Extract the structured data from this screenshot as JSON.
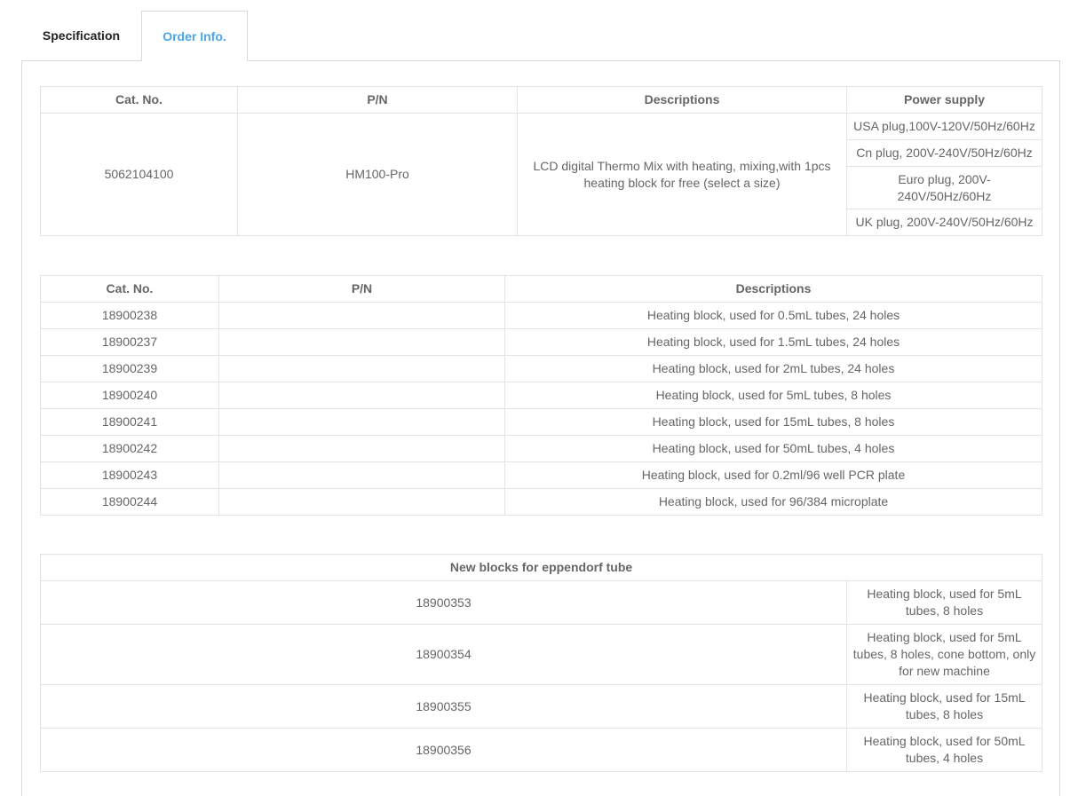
{
  "tabs": [
    {
      "label": "Specification",
      "active": false
    },
    {
      "label": "Order Info.",
      "active": true
    }
  ],
  "colors": {
    "active_tab": "#4aa6e8",
    "border": "#e3e3e3",
    "text": "#666666"
  },
  "table1": {
    "headers": [
      "Cat. No.",
      "P/N",
      "Descriptions",
      "Power supply"
    ],
    "cat_no": "5062104100",
    "pn": "HM100-Pro",
    "description": "LCD digital Thermo Mix with heating, mixing,with 1pcs heating block for free (select a size)",
    "power_supply": [
      "USA plug,100V-120V/50Hz/60Hz",
      "Cn plug, 200V-240V/50Hz/60Hz",
      "Euro plug, 200V-240V/50Hz/60Hz",
      "UK plug, 200V-240V/50Hz/60Hz"
    ]
  },
  "table2": {
    "headers": [
      "Cat. No.",
      "P/N",
      "Descriptions"
    ],
    "rows": [
      {
        "cat": "18900238",
        "pn": "",
        "desc": "Heating block, used for 0.5mL tubes, 24 holes"
      },
      {
        "cat": "18900237",
        "pn": "",
        "desc": "Heating block, used for 1.5mL tubes, 24 holes"
      },
      {
        "cat": "18900239",
        "pn": "",
        "desc": "Heating block, used for 2mL tubes, 24 holes"
      },
      {
        "cat": "18900240",
        "pn": "",
        "desc": "Heating block, used for 5mL tubes, 8 holes"
      },
      {
        "cat": "18900241",
        "pn": "",
        "desc": "Heating block, used for 15mL tubes, 8 holes"
      },
      {
        "cat": "18900242",
        "pn": "",
        "desc": "Heating block, used for 50mL tubes, 4 holes"
      },
      {
        "cat": "18900243",
        "pn": "",
        "desc": "Heating block, used for 0.2ml/96 well PCR plate"
      },
      {
        "cat": "18900244",
        "pn": "",
        "desc": "Heating block, used for 96/384 microplate"
      }
    ]
  },
  "table3": {
    "header": "New blocks for eppendorf  tube",
    "rows": [
      {
        "cat": "18900353",
        "desc": "Heating block, used for 5mL tubes, 8 holes"
      },
      {
        "cat": "18900354",
        "desc": "Heating block, used for 5mL tubes, 8 holes, cone bottom, only for new machine"
      },
      {
        "cat": "18900355",
        "desc": "Heating block, used for 15mL tubes, 8 holes"
      },
      {
        "cat": "18900356",
        "desc": "Heating block, used for 50mL tubes, 4 holes"
      }
    ]
  }
}
